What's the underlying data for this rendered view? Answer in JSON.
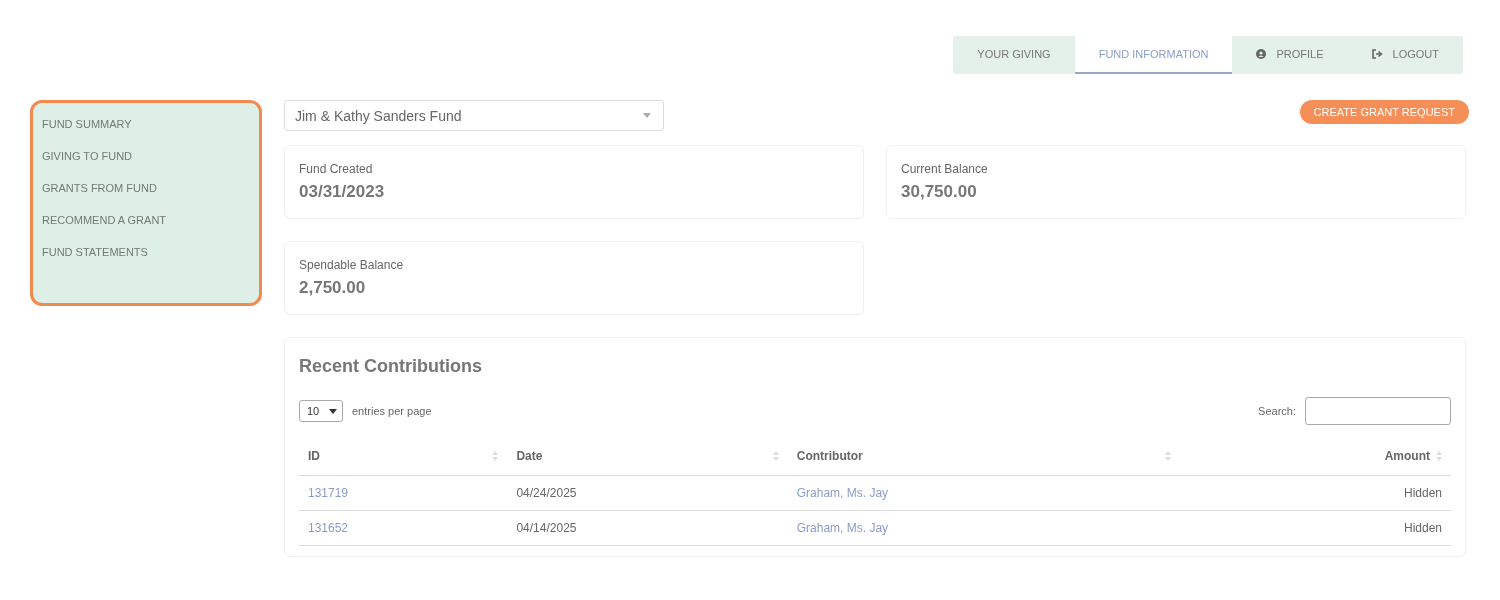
{
  "nav_tabs": [
    {
      "label": "YOUR GIVING",
      "kind": "text",
      "selected": false
    },
    {
      "label": "FUND INFORMATION",
      "kind": "text",
      "selected": true
    },
    {
      "label": "PROFILE",
      "kind": "account",
      "selected": false
    },
    {
      "label": "LOGOUT",
      "kind": "exit",
      "selected": false
    }
  ],
  "sidebar": {
    "items": [
      {
        "label": "FUND SUMMARY"
      },
      {
        "label": "GIVING TO FUND"
      },
      {
        "label": "GRANTS FROM FUND"
      },
      {
        "label": "RECOMMEND A GRANT"
      },
      {
        "label": "FUND STATEMENTS"
      }
    ]
  },
  "fund_select": {
    "value": "Jim & Kathy Sanders Fund"
  },
  "create_button": "CREATE GRANT REQUEST",
  "stats": [
    {
      "label": "Fund Created",
      "value": "03/31/2023"
    },
    {
      "label": "Current Balance",
      "value": "30,750.00"
    },
    {
      "label": "Spendable Balance",
      "value": "2,750.00"
    }
  ],
  "contributions": {
    "title": "Recent Contributions",
    "page_size": "10",
    "page_size_label": "entries per page",
    "search_label": "Search:",
    "columns": [
      "ID",
      "Date",
      "Contributor",
      "Amount"
    ],
    "rows": [
      {
        "id": "131719",
        "date": "04/24/2025",
        "contributor": "Graham, Ms. Jay",
        "amount": "Hidden"
      },
      {
        "id": "131652",
        "date": "04/14/2025",
        "contributor": "Graham, Ms. Jay",
        "amount": "Hidden"
      }
    ]
  }
}
